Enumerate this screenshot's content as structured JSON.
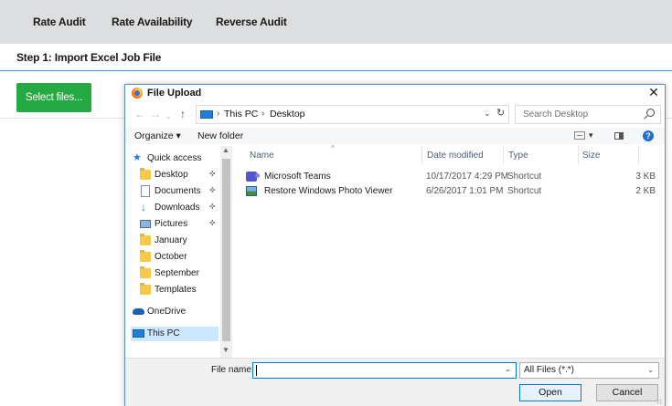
{
  "topnav": {
    "links": [
      "Rate Audit",
      "Rate Availability",
      "Reverse Audit"
    ]
  },
  "step": {
    "title": "Step 1: Import Excel Job File"
  },
  "upload_button": {
    "label": "Select files..."
  },
  "dialog": {
    "title": "File Upload",
    "close_glyph": "✕",
    "address": {
      "crumbs": [
        "This PC",
        "Desktop"
      ],
      "separator": "›"
    },
    "search": {
      "placeholder": "Search Desktop"
    },
    "toolbar": {
      "organize": "Organize ▾",
      "new_folder": "New folder",
      "help": "?"
    },
    "nav": {
      "items": [
        {
          "label": "Quick access",
          "icon": "star-icon",
          "pinned": false
        },
        {
          "label": "Desktop",
          "icon": "folder-icon",
          "pinned": true
        },
        {
          "label": "Documents",
          "icon": "documents-icon",
          "pinned": true
        },
        {
          "label": "Downloads",
          "icon": "download-icon",
          "pinned": true
        },
        {
          "label": "Pictures",
          "icon": "pictures-icon",
          "pinned": true
        },
        {
          "label": "January",
          "icon": "folder-icon",
          "pinned": false
        },
        {
          "label": "October",
          "icon": "folder-icon",
          "pinned": false
        },
        {
          "label": "September",
          "icon": "folder-icon",
          "pinned": false
        },
        {
          "label": "Templates",
          "icon": "folder-icon",
          "pinned": false
        },
        {
          "label": "OneDrive",
          "icon": "cloud-icon",
          "pinned": false
        },
        {
          "label": "This PC",
          "icon": "computer-icon",
          "pinned": false,
          "selected": true
        }
      ]
    },
    "columns": {
      "name": "Name",
      "date": "Date modified",
      "type": "Type",
      "size": "Size"
    },
    "files": [
      {
        "name": "Microsoft Teams",
        "date": "10/17/2017 4:29 PM",
        "type": "Shortcut",
        "size": "3 KB",
        "icon": "teams-icon"
      },
      {
        "name": "Restore Windows Photo Viewer",
        "date": "6/26/2017 1:01 PM",
        "type": "Shortcut",
        "size": "2 KB",
        "icon": "photo-viewer-icon"
      }
    ],
    "footer": {
      "file_name_label": "File name:",
      "file_name_value": "",
      "file_type": "All Files (*.*)",
      "open_label": "Open",
      "cancel_label": "Cancel"
    }
  },
  "colors": {
    "nav_bg": "#dcdedf",
    "accent_green": "#25a942",
    "selection": "#cce8ff",
    "focus_blue": "#0078d7"
  }
}
